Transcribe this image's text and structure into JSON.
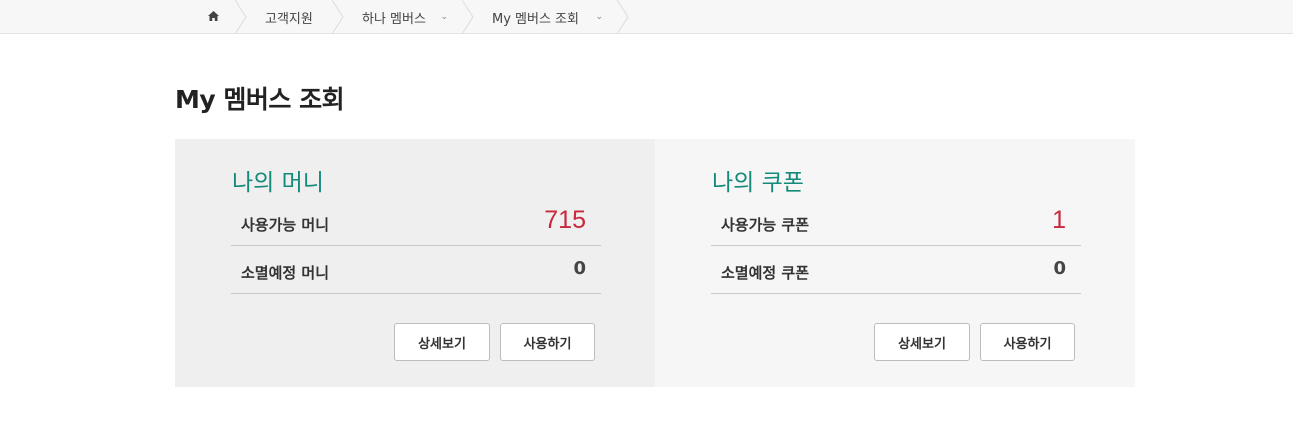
{
  "breadcrumb": {
    "home_icon": "home-icon",
    "items": [
      {
        "label": "고객지원"
      },
      {
        "label": "하나 멤버스",
        "has_dropdown": true
      },
      {
        "label": "My 멤버스 조회",
        "has_dropdown": true
      }
    ],
    "caret_glyph": "⌄"
  },
  "page": {
    "title": "My 멤버스 조회"
  },
  "money": {
    "heading": "나의 머니",
    "rows": [
      {
        "label": "사용가능 머니",
        "value": "715"
      },
      {
        "label": "소멸예정 머니",
        "value": "0"
      }
    ],
    "buttons": {
      "detail": "상세보기",
      "use": "사용하기"
    }
  },
  "coupon": {
    "heading": "나의 쿠폰",
    "rows": [
      {
        "label": "사용가능 쿠폰",
        "value": "1"
      },
      {
        "label": "소멸예정 쿠폰",
        "value": "0"
      }
    ],
    "buttons": {
      "detail": "상세보기",
      "use": "사용하기"
    }
  },
  "colors": {
    "accent_green": "#138a7a",
    "value_red": "#c8283b"
  }
}
